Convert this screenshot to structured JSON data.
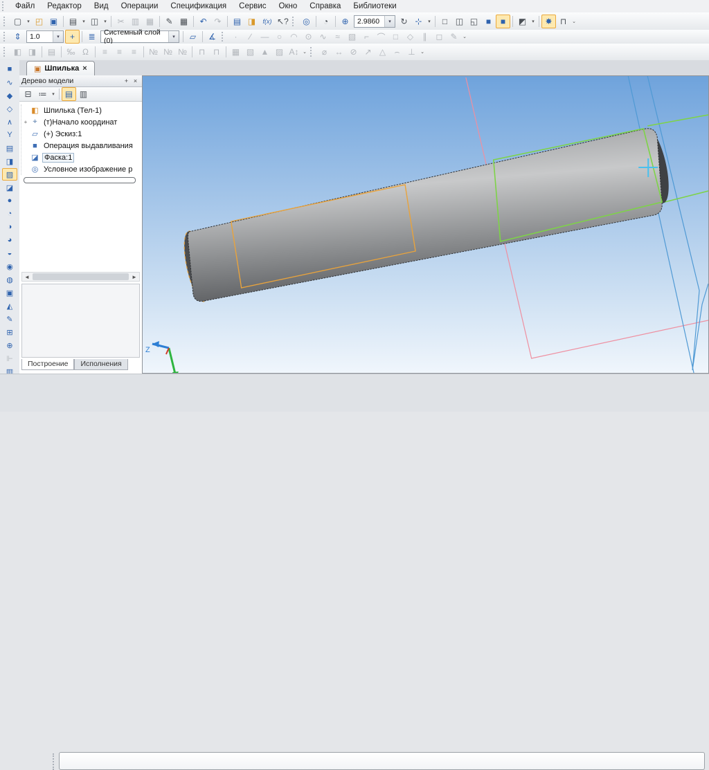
{
  "menu": {
    "items": [
      {
        "n": "menu-file",
        "label": "Файл"
      },
      {
        "n": "menu-editor",
        "label": "Редактор"
      },
      {
        "n": "menu-view",
        "label": "Вид"
      },
      {
        "n": "menu-operations",
        "label": "Операции"
      },
      {
        "n": "menu-specification",
        "label": "Спецификация"
      },
      {
        "n": "menu-service",
        "label": "Сервис"
      },
      {
        "n": "menu-window",
        "label": "Окно"
      },
      {
        "n": "menu-help",
        "label": "Справка"
      },
      {
        "n": "menu-libraries",
        "label": "Библиотеки"
      }
    ]
  },
  "toolbar_main": {
    "left_items": [
      {
        "n": "new-document-button",
        "g": "▢"
      },
      {
        "n": "new-dropdown",
        "g": "▾",
        "c": "dd",
        "i": "true"
      },
      {
        "n": "open-button",
        "g": "◰",
        "c": "tbtn amber"
      },
      {
        "n": "save-button",
        "g": "▣",
        "c": "tbtn blue"
      },
      {
        "n": "separator",
        "g": "",
        "c": "sep",
        "i": "false"
      },
      {
        "n": "print-button",
        "g": "▤"
      },
      {
        "n": "print-dropdown",
        "g": "▾",
        "c": "dd"
      },
      {
        "n": "preview-button",
        "g": "◫"
      },
      {
        "n": "preview-dropdown",
        "g": "▾",
        "c": "dd"
      },
      {
        "n": "separator",
        "g": "",
        "c": "sep",
        "i": "false"
      },
      {
        "n": "cut-button",
        "g": "✂",
        "c": "tbtn dis"
      },
      {
        "n": "copy-button",
        "g": "▥",
        "c": "tbtn dis"
      },
      {
        "n": "paste-button",
        "g": "▦",
        "c": "tbtn dis"
      },
      {
        "n": "separator",
        "g": "",
        "c": "sep",
        "i": "false"
      },
      {
        "n": "copy-properties-button",
        "g": "✎"
      },
      {
        "n": "table-button",
        "g": "▦"
      },
      {
        "n": "separator",
        "g": "",
        "c": "sep",
        "i": "false"
      },
      {
        "n": "undo-button",
        "g": "↶",
        "c": "tbtn blue"
      },
      {
        "n": "redo-button",
        "g": "↷",
        "c": "tbtn dis"
      },
      {
        "n": "separator",
        "g": "",
        "c": "sep",
        "i": "false"
      },
      {
        "n": "variables-button",
        "g": "▤",
        "c": "tbtn blue"
      },
      {
        "n": "library-manager-button",
        "g": "◨",
        "c": "tbtn amber"
      },
      {
        "n": "fx-button",
        "g": "f(x)",
        "c": "tbtn fx"
      },
      {
        "n": "context-help-button",
        "g": "↖?"
      }
    ],
    "zoom_items": [
      {
        "n": "zoom-frame-button",
        "g": "◎",
        "c": "tbtn blue"
      },
      {
        "n": "separator",
        "g": "",
        "c": "sep",
        "i": "false"
      },
      {
        "n": "zoom-select-button",
        "g": "◔"
      },
      {
        "n": "separator",
        "g": "",
        "c": "sep",
        "i": "false"
      },
      {
        "n": "zoom-in-button",
        "g": "⊕",
        "c": "tbtn blue"
      }
    ],
    "zoom_value": "2.9860",
    "right_items": [
      {
        "n": "rebuild-button",
        "g": "↻"
      },
      {
        "n": "orientation-button",
        "g": "⊹",
        "c": "tbtn blue"
      },
      {
        "n": "orientation-dropdown",
        "g": "▾",
        "c": "dd"
      },
      {
        "n": "separator",
        "g": "",
        "c": "sep",
        "i": "false"
      },
      {
        "n": "display-wireframe-button",
        "g": "□"
      },
      {
        "n": "display-hidden-removed-button",
        "g": "◫"
      },
      {
        "n": "display-hidden-thin-button",
        "g": "◱"
      },
      {
        "n": "display-shaded-button",
        "g": "■",
        "c": "tbtn blue"
      },
      {
        "n": "display-shaded-edges-button",
        "g": "■",
        "c": "tbtn blue hl"
      },
      {
        "n": "separator",
        "g": "",
        "c": "sep",
        "i": "false"
      },
      {
        "n": "section-view-button",
        "g": "◩"
      },
      {
        "n": "section-dropdown",
        "g": "▾",
        "c": "dd"
      },
      {
        "n": "separator",
        "g": "",
        "c": "sep",
        "i": "false"
      },
      {
        "n": "hide-all-objects-button",
        "g": "✸",
        "c": "tbtn blue hl"
      },
      {
        "n": "model-dimensions-button",
        "g": "⊓"
      },
      {
        "n": "toolbar-overflow",
        "g": "⌄",
        "c": "dd"
      }
    ]
  },
  "toolbar_current": {
    "scale_icon_items": [
      {
        "n": "document-scale-icon",
        "g": "⇕",
        "c": "tbtn blue"
      }
    ],
    "scale_value": "1.0",
    "snap_items": [
      {
        "n": "snaps-button",
        "g": "+",
        "c": "tbtn hl"
      },
      {
        "n": "separator",
        "g": "",
        "c": "sep",
        "i": "false"
      },
      {
        "n": "layers-button",
        "g": "≣",
        "c": "tbtn blue"
      }
    ],
    "layer_value": "Системный слой (0)",
    "after_items": [
      {
        "n": "separator",
        "g": "",
        "c": "sep",
        "i": "false"
      },
      {
        "n": "layout-button",
        "g": "▱",
        "c": "tbtn blue"
      },
      {
        "n": "separator",
        "g": "",
        "c": "sep",
        "i": "false"
      },
      {
        "n": "angle-button",
        "g": "∡",
        "c": "tbtn blue"
      }
    ],
    "geometry_items": [
      {
        "n": "point-tool",
        "g": "·",
        "c": "tbtn dis"
      },
      {
        "n": "auxiliary-line-tool",
        "g": "∕",
        "c": "tbtn dis"
      },
      {
        "n": "segment-tool",
        "g": "―",
        "c": "tbtn dis"
      },
      {
        "n": "circle-tool",
        "g": "○",
        "c": "tbtn dis"
      },
      {
        "n": "arc-tool",
        "g": "◠",
        "c": "tbtn dis"
      },
      {
        "n": "ellipse-tool",
        "g": "⊙",
        "c": "tbtn dis"
      },
      {
        "n": "spline-tool",
        "g": "∿",
        "c": "tbtn dis"
      },
      {
        "n": "bezier-tool",
        "g": "≈",
        "c": "tbtn dis"
      },
      {
        "n": "hatch-tool",
        "g": "▧",
        "c": "tbtn dis"
      },
      {
        "n": "chamfer-tool",
        "g": "⌐",
        "c": "tbtn dis"
      },
      {
        "n": "fillet-tool",
        "g": "⌒",
        "c": "tbtn dis"
      },
      {
        "n": "rectangle-tool",
        "g": "□",
        "c": "tbtn dis"
      },
      {
        "n": "polygon-tool",
        "g": "◇",
        "c": "tbtn dis"
      },
      {
        "n": "parallel-tool",
        "g": "∥",
        "c": "tbtn dis"
      },
      {
        "n": "contour-tool",
        "g": "◻",
        "c": "tbtn dis"
      },
      {
        "n": "pencil-tool",
        "g": "✎",
        "c": "tbtn dis"
      },
      {
        "n": "geometry-overflow",
        "g": "⌄",
        "c": "dd"
      }
    ]
  },
  "toolbar_views": {
    "a_items": [
      {
        "n": "new-view-button",
        "g": "◧",
        "c": "tbtn dis"
      },
      {
        "n": "view-copy-button",
        "g": "◨",
        "c": "tbtn dis"
      },
      {
        "n": "separator",
        "g": "",
        "c": "sep",
        "i": "false"
      },
      {
        "n": "view-from-model-button",
        "g": "▤",
        "c": "tbtn dis"
      },
      {
        "n": "separator",
        "g": "",
        "c": "sep",
        "i": "false"
      },
      {
        "n": "scale-percent-button",
        "g": "‰",
        "c": "tbtn dis"
      },
      {
        "n": "omega-button",
        "g": "Ω",
        "c": "tbtn dis"
      },
      {
        "n": "separator",
        "g": "",
        "c": "sep",
        "i": "false"
      },
      {
        "n": "align-top-button",
        "g": "≡",
        "c": "tbtn dis"
      },
      {
        "n": "align-mid-button",
        "g": "≡",
        "c": "tbtn dis"
      },
      {
        "n": "align-bottom-button",
        "g": "≡",
        "c": "tbtn dis"
      },
      {
        "n": "separator",
        "g": "",
        "c": "sep",
        "i": "false"
      },
      {
        "n": "numbered-1-button",
        "g": "№",
        "c": "tbtn dis"
      },
      {
        "n": "numbered-2-button",
        "g": "№",
        "c": "tbtn dis"
      },
      {
        "n": "numbered-3-button",
        "g": "№",
        "c": "tbtn dis"
      },
      {
        "n": "separator",
        "g": "",
        "c": "sep",
        "i": "false"
      },
      {
        "n": "pin-1-button",
        "g": "⊓",
        "c": "tbtn dis"
      },
      {
        "n": "pin-2-button",
        "g": "⊓",
        "c": "tbtn dis"
      },
      {
        "n": "separator",
        "g": "",
        "c": "sep",
        "i": "false"
      },
      {
        "n": "table-grid-button",
        "g": "▦",
        "c": "tbtn dis"
      },
      {
        "n": "hatch-grid-button",
        "g": "▧",
        "c": "tbtn dis"
      },
      {
        "n": "triangle-button",
        "g": "▲",
        "c": "tbtn dis"
      },
      {
        "n": "dense-grid-button",
        "g": "▨",
        "c": "tbtn dis"
      },
      {
        "n": "text-height-button",
        "g": "A↕",
        "c": "tbtn dis"
      },
      {
        "n": "views-overflow",
        "g": "⌄",
        "c": "dd"
      }
    ],
    "b_items": [
      {
        "n": "auto-dimension-button",
        "g": "⌀",
        "c": "tbtn dis"
      },
      {
        "n": "linear-dimension-button",
        "g": "↔",
        "c": "tbtn dis"
      },
      {
        "n": "diameter-dimension-button",
        "g": "⊘",
        "c": "tbtn dis"
      },
      {
        "n": "radial-dimension-button",
        "g": "↗",
        "c": "tbtn dis"
      },
      {
        "n": "angular-dimension-button",
        "g": "△",
        "c": "tbtn dis"
      },
      {
        "n": "arc-dimension-button",
        "g": "⌢",
        "c": "tbtn dis"
      },
      {
        "n": "height-dimension-button",
        "g": "⊥",
        "c": "tbtn dis"
      },
      {
        "n": "dimension-overflow",
        "g": "⌄",
        "c": "dd"
      }
    ]
  },
  "document_tabs": {
    "active_label": "Шпилька",
    "icon_glyph": "▣",
    "close_glyph": "×"
  },
  "compact_panel": {
    "items": [
      {
        "n": "edit-part-button",
        "g": "■"
      },
      {
        "n": "spatial-curves-button",
        "g": "∿"
      },
      {
        "n": "surfaces-button",
        "g": "◆"
      },
      {
        "n": "arrays-button",
        "g": "◇"
      },
      {
        "n": "measure-button",
        "g": "∧"
      },
      {
        "n": "filters-button",
        "g": "Y"
      },
      {
        "n": "specification-button",
        "g": "▤"
      },
      {
        "n": "reports-button",
        "g": "◨"
      },
      {
        "n": "sketch-button",
        "g": "▨",
        "c": "cbtn hl"
      },
      {
        "n": "extrude-button",
        "g": "◪"
      },
      {
        "n": "revolve-button",
        "g": "●"
      },
      {
        "n": "kinematic-button",
        "g": "◔"
      },
      {
        "n": "loft-button",
        "g": "◑"
      },
      {
        "n": "chamfer-button",
        "g": "◕"
      },
      {
        "n": "fillet-button",
        "g": "◒"
      },
      {
        "n": "hole-button",
        "g": "◉"
      },
      {
        "n": "rib-button",
        "g": "◍"
      },
      {
        "n": "shell-button",
        "g": "▣"
      },
      {
        "n": "incline-button",
        "g": "◭"
      },
      {
        "n": "sketch-edit-button",
        "g": "✎"
      },
      {
        "n": "plane-button",
        "g": "⊞"
      },
      {
        "n": "axis-button",
        "g": "⊕"
      },
      {
        "n": "condition-button",
        "g": "⊩",
        "c": "cbtn dis"
      },
      {
        "n": "flag-button",
        "g": "▥"
      }
    ],
    "expander_glyph": "▸"
  },
  "model_tree": {
    "title": "Дерево модели",
    "pin_glyph": "+",
    "close_glyph": "×",
    "toolbar_items": [
      {
        "n": "tree-structure-button",
        "g": "⊟",
        "c": "tbtn"
      },
      {
        "n": "tree-composition-button",
        "g": "≔",
        "c": "tbtn"
      },
      {
        "n": "tree-composition-dropdown",
        "g": "▾",
        "c": "dd"
      },
      {
        "n": "separator",
        "g": "",
        "c": "sep",
        "i": "false"
      },
      {
        "n": "tree-sections-button",
        "g": "▤",
        "c": "tbtn hl"
      },
      {
        "n": "tree-additional-button",
        "g": "▥",
        "c": "tbtn"
      }
    ],
    "items": [
      {
        "n": "tree-item-part",
        "e": "",
        "g": "◧",
        "ic": "color:#d98b2a",
        "label": "Шпилька (Тел-1)"
      },
      {
        "n": "tree-item-origin",
        "e": "+",
        "g": "⌖",
        "ic": "color:#5b7fae",
        "label": "(т)Начало координат"
      },
      {
        "n": "tree-item-sketch",
        "e": "",
        "g": "▱",
        "ic": "color:#3f6fb5",
        "label": "(+) Эскиз:1"
      },
      {
        "n": "tree-item-extrusion",
        "e": "",
        "g": "■",
        "ic": "color:#3f6fb5",
        "label": "Операция выдавливания"
      },
      {
        "n": "tree-item-chamfer",
        "e": "",
        "g": "◪",
        "ic": "color:#3f6fb5",
        "label": "Фаска:1",
        "ls": "border:1px solid #9fb6cc;background:#f2f6fa"
      },
      {
        "n": "tree-item-thread",
        "e": "",
        "g": "◎",
        "ic": "color:#3f6fb5",
        "label": "Условное изображение р"
      }
    ],
    "scroll_left_glyph": "◄",
    "scroll_right_glyph": "►",
    "bottom_tabs": [
      {
        "n": "tab-construction",
        "label": "Построение",
        "c": "btab active"
      },
      {
        "n": "tab-executions",
        "label": "Исполнения",
        "c": "btab"
      }
    ]
  },
  "viewport": {
    "axis_z_label": "Z",
    "axis_y_label": "Y",
    "colors": {
      "bg_top": "#6fa3dc",
      "bg_bottom": "#f0f6fc",
      "body_edge": "#2e3033",
      "sketch_outline": "#e8a33d",
      "face_highlight": "#7ed348",
      "plane_pink": "#ef8fa0",
      "plane_blue": "#4f99d4",
      "cross_cyan": "#49c0ee"
    }
  }
}
